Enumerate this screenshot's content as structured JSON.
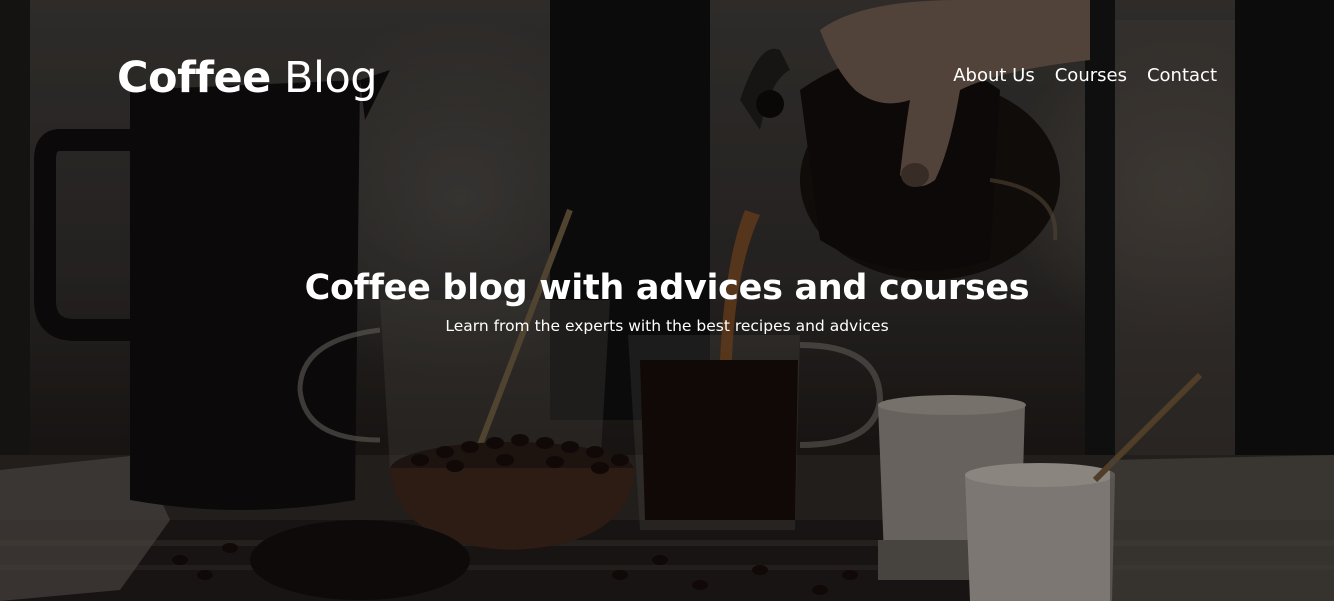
{
  "brand": {
    "name_bold": "Coffee",
    "name_light": "Blog"
  },
  "nav": {
    "items": [
      {
        "label": "About Us"
      },
      {
        "label": "Courses"
      },
      {
        "label": "Contact"
      }
    ]
  },
  "hero": {
    "title": "Coffee blog with advices and courses",
    "subtitle": "Learn from the experts with the best recipes and advices"
  },
  "colors": {
    "text": "#ffffff",
    "overlay": "#0a0806",
    "coffee": "#1a0f0a"
  }
}
